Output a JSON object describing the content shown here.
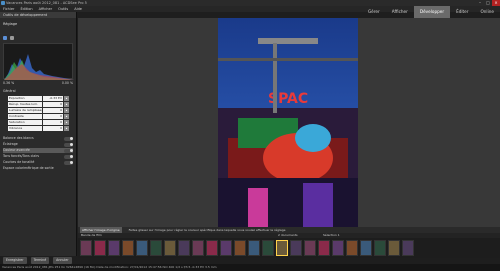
{
  "window": {
    "title": "Vacances Paris août 2012_081 - ACDSee Pro 5"
  },
  "menu": {
    "items": [
      "Fichier",
      "Édition",
      "Afficher",
      "Outils",
      "Aide"
    ]
  },
  "nav": {
    "tabs": [
      {
        "label": "Gérer",
        "active": false
      },
      {
        "label": "Afficher",
        "active": false
      },
      {
        "label": "Développer",
        "active": true
      },
      {
        "label": "Éditer",
        "active": false
      },
      {
        "label": "Online",
        "active": false
      }
    ]
  },
  "panel": {
    "title": "Outils de développement",
    "section": "Réglage",
    "hist_left": "0.36 %",
    "hist_right": "0.00 %",
    "general": "Général",
    "props": [
      {
        "label": "Exposition",
        "value": "-0.33 EV"
      },
      {
        "label": "Récup. hautes lum.",
        "value": "0"
      },
      {
        "label": "Lumière de remplissage",
        "value": "0"
      },
      {
        "label": "Contraste",
        "value": "0"
      },
      {
        "label": "Saturation",
        "value": "0"
      },
      {
        "label": "Vibrance",
        "value": "0"
      }
    ],
    "sections": [
      "Balance des blancs",
      "Éclairage",
      "Couleur avancée",
      "Tons foncés/Tons clairs",
      "Courbes de tonalité",
      "Espace colorimétrique de sortie"
    ],
    "buttons": [
      "Enregistrer",
      "Terminé",
      "Annuler"
    ]
  },
  "infobar": {
    "badge": "Afficher l'image d'origine",
    "message": "Faites glisser sur l'image pour régler la couleur spécifique dans laquelle vous voulez effectuer le réglage"
  },
  "filmstrip": {
    "label": "Bande de film",
    "count_label": "2 documents",
    "selection_label": "Sélection 1",
    "thumb_count": 24,
    "selected_index": 14
  },
  "statusbar": {
    "text": "Vacances Paris août 2012_081.JPG   251 Ko   3264x4896 (16 Mo)   Date de modification: 27/01/2012 15:47:56   ISO 400   1/2 s   f/3.5   -0.33 EV   3.5 mm"
  },
  "colors": {
    "accent": "#6a6a6a",
    "selected_thumb": "#ffd24a",
    "close": "#b22222"
  }
}
